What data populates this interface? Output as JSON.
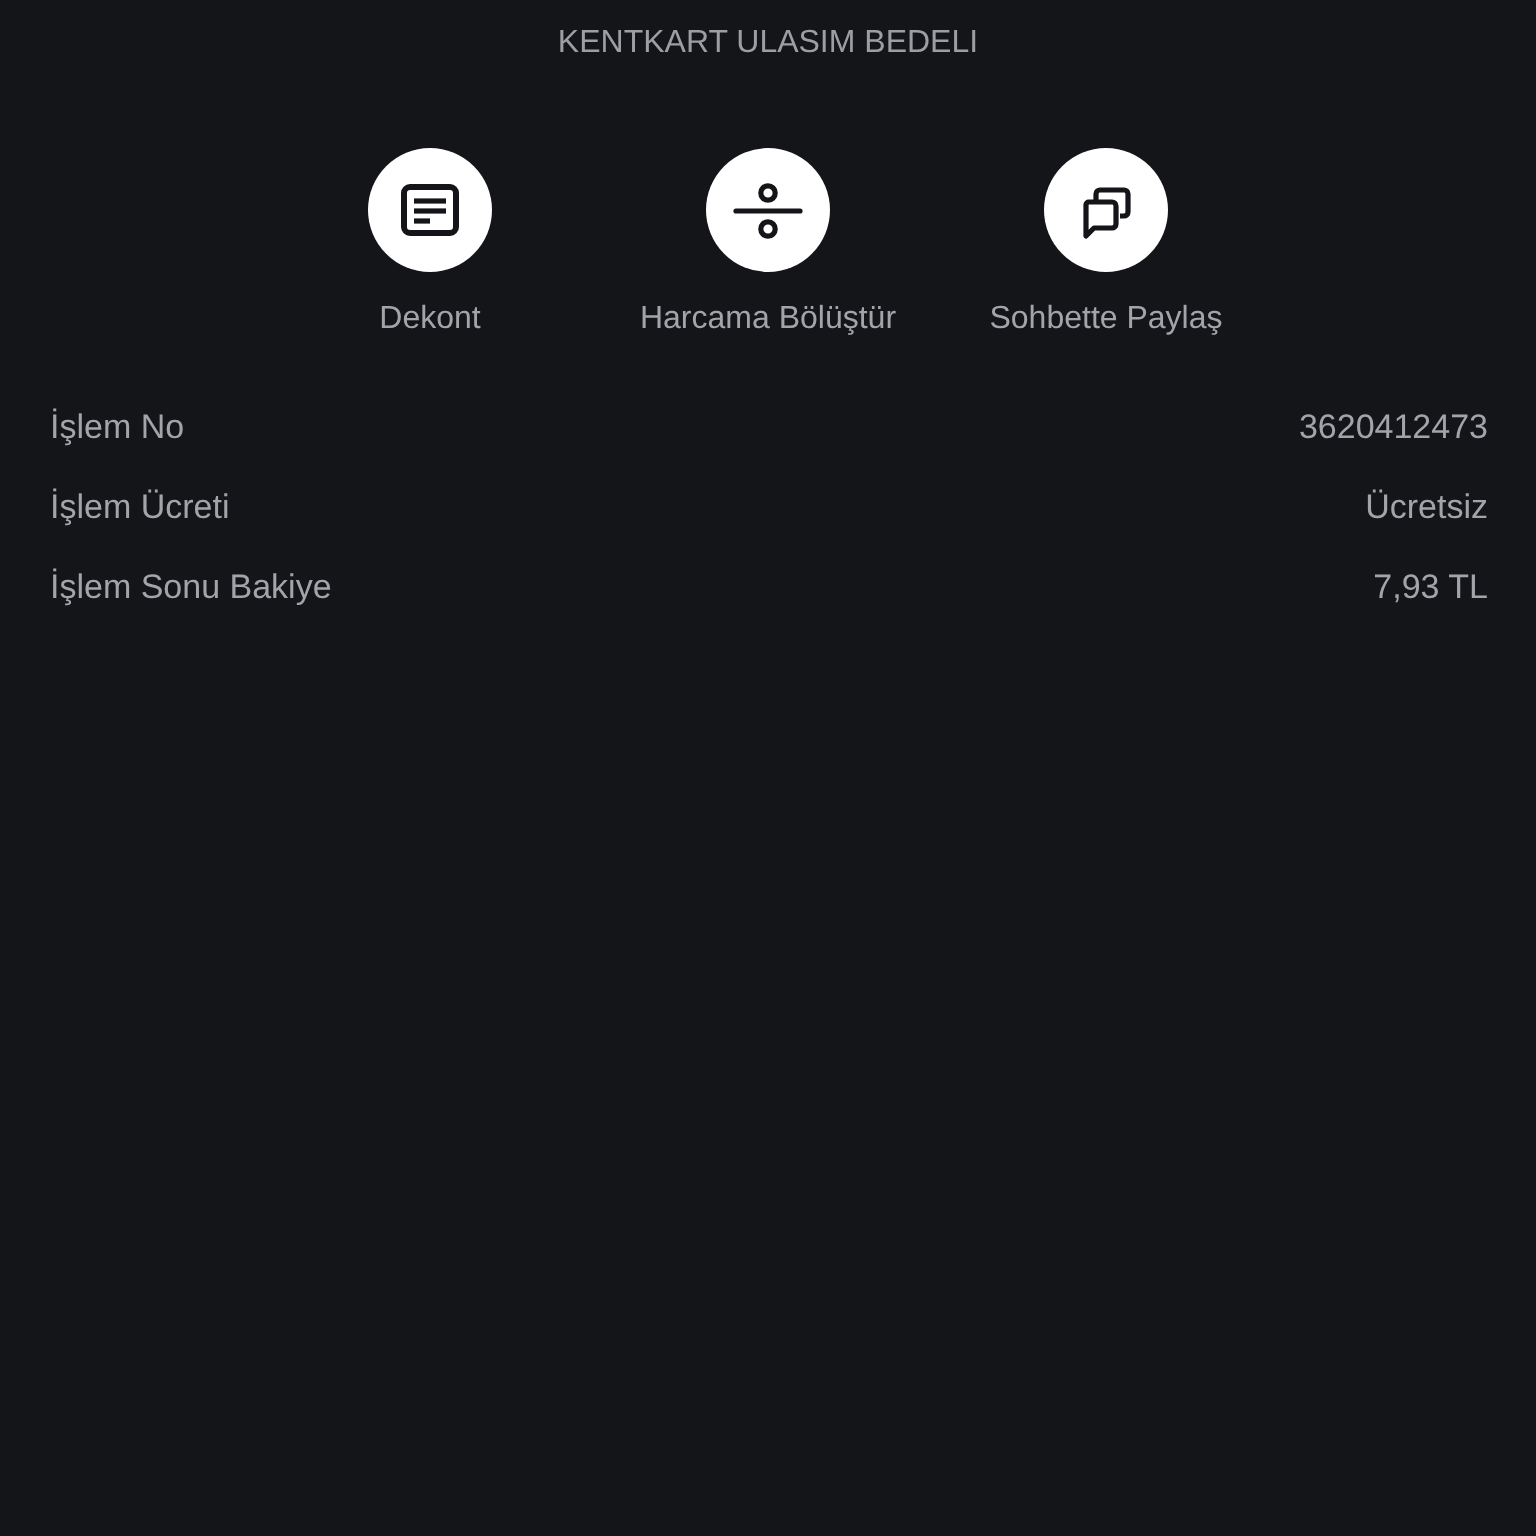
{
  "header": {
    "title": "KENTKART ULASIM BEDELI"
  },
  "actions": [
    {
      "kind": "receipt",
      "label": "Dekont"
    },
    {
      "kind": "split",
      "label": "Harcama Bölüştür"
    },
    {
      "kind": "chat",
      "label": "Sohbette Paylaş"
    }
  ],
  "details": [
    {
      "label": "İşlem No",
      "value": "3620412473"
    },
    {
      "label": "İşlem Ücreti",
      "value": "Ücretsiz"
    },
    {
      "label": "İşlem Sonu Bakiye",
      "value": "7,93 TL"
    }
  ]
}
